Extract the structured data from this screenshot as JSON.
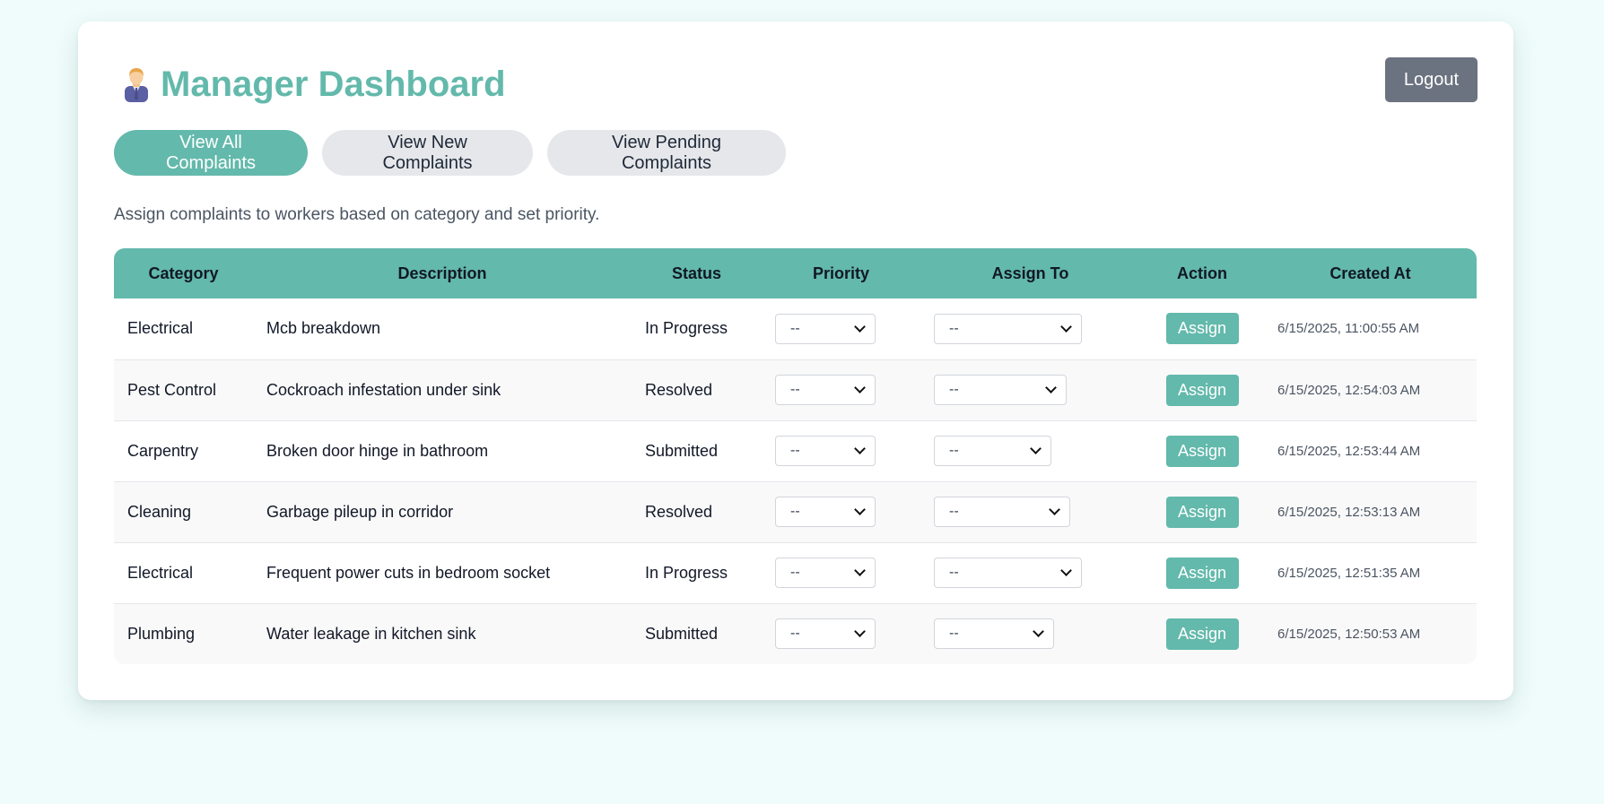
{
  "header": {
    "title": "Manager Dashboard",
    "title_icon": "manager-emoji",
    "logout_label": "Logout"
  },
  "filters": {
    "all": "View All Complaints",
    "new": "View New Complaints",
    "pending": "View Pending Complaints",
    "active": "all"
  },
  "subtitle": "Assign complaints to workers based on category and set priority.",
  "table": {
    "headers": {
      "category": "Category",
      "description": "Description",
      "status": "Status",
      "priority": "Priority",
      "assign_to": "Assign To",
      "action": "Action",
      "created_at": "Created At"
    },
    "rows": [
      {
        "category": "Electrical",
        "description": "Mcb breakdown",
        "status": "In Progress",
        "priority": "--",
        "assign_to": "--",
        "action": "Assign",
        "created_at": "6/15/2025, 11:00:55 AM"
      },
      {
        "category": "Pest Control",
        "description": "Cockroach infestation under sink",
        "status": "Resolved",
        "priority": "--",
        "assign_to": "--",
        "action": "Assign",
        "created_at": "6/15/2025, 12:54:03 AM"
      },
      {
        "category": "Carpentry",
        "description": "Broken door hinge in bathroom",
        "status": "Submitted",
        "priority": "--",
        "assign_to": "--",
        "action": "Assign",
        "created_at": "6/15/2025, 12:53:44 AM"
      },
      {
        "category": "Cleaning",
        "description": "Garbage pileup in corridor",
        "status": "Resolved",
        "priority": "--",
        "assign_to": "--",
        "action": "Assign",
        "created_at": "6/15/2025, 12:53:13 AM"
      },
      {
        "category": "Electrical",
        "description": "Frequent power cuts in bedroom socket",
        "status": "In Progress",
        "priority": "--",
        "assign_to": "--",
        "action": "Assign",
        "created_at": "6/15/2025, 12:51:35 AM"
      },
      {
        "category": "Plumbing",
        "description": "Water leakage in kitchen sink",
        "status": "Submitted",
        "priority": "--",
        "assign_to": "--",
        "action": "Assign",
        "created_at": "6/15/2025, 12:50:53 AM"
      }
    ]
  },
  "colors": {
    "accent": "#63b9ab",
    "page_bg": "#effcfb",
    "logout_bg": "#6b7280",
    "pill_inactive": "#e5e7eb"
  }
}
